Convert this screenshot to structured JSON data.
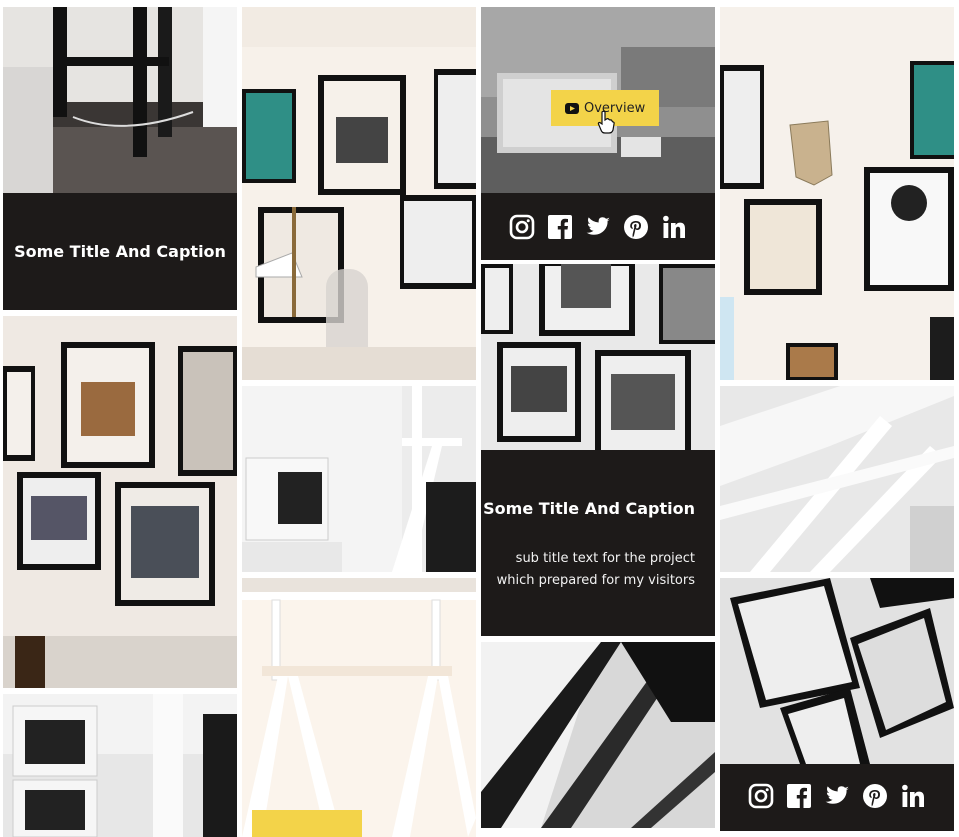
{
  "gallery": {
    "caption_top_left": {
      "title": "Some Title And Caption"
    },
    "caption_middle": {
      "title": "Some Title And Caption",
      "subtitle_line1": "sub title text for the project",
      "subtitle_line2": "which prepared for my visitors"
    },
    "overview_button": {
      "label": "Overview",
      "icon": "youtube-play-icon"
    },
    "social_icons": [
      "instagram-icon",
      "facebook-icon",
      "twitter-icon",
      "pinterest-icon",
      "linkedin-icon"
    ]
  },
  "colors": {
    "caption_bg": "#1d1a19",
    "button_bg": "#f3d349",
    "text_light": "#ffffff"
  }
}
